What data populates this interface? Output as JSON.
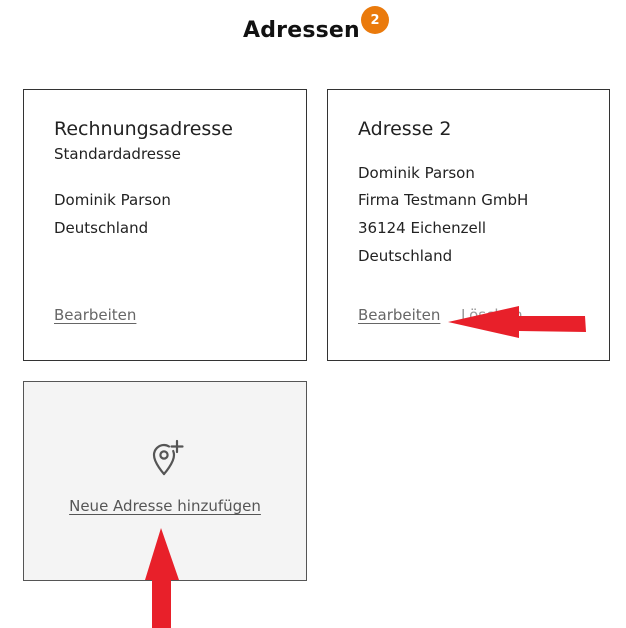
{
  "header": {
    "title": "Adressen",
    "count_badge": "2"
  },
  "cards": [
    {
      "title": "Rechnungsadresse",
      "subtitle": "Standardadresse",
      "lines": [
        "Dominik Parson",
        "Deutschland"
      ],
      "edit_label": "Bearbeiten"
    },
    {
      "title": "Adresse 2",
      "lines": [
        "Dominik Parson",
        "Firma Testmann GmbH",
        "36124 Eichenzell",
        "Deutschland"
      ],
      "edit_label": "Bearbeiten",
      "delete_label": "Löschen"
    }
  ],
  "add_address": {
    "label": "Neue Adresse hinzufügen",
    "icon": "map-pin-plus-icon"
  },
  "annotations": {
    "arrow_color": "#e8202a",
    "badge_color": "#ea7a0c"
  }
}
